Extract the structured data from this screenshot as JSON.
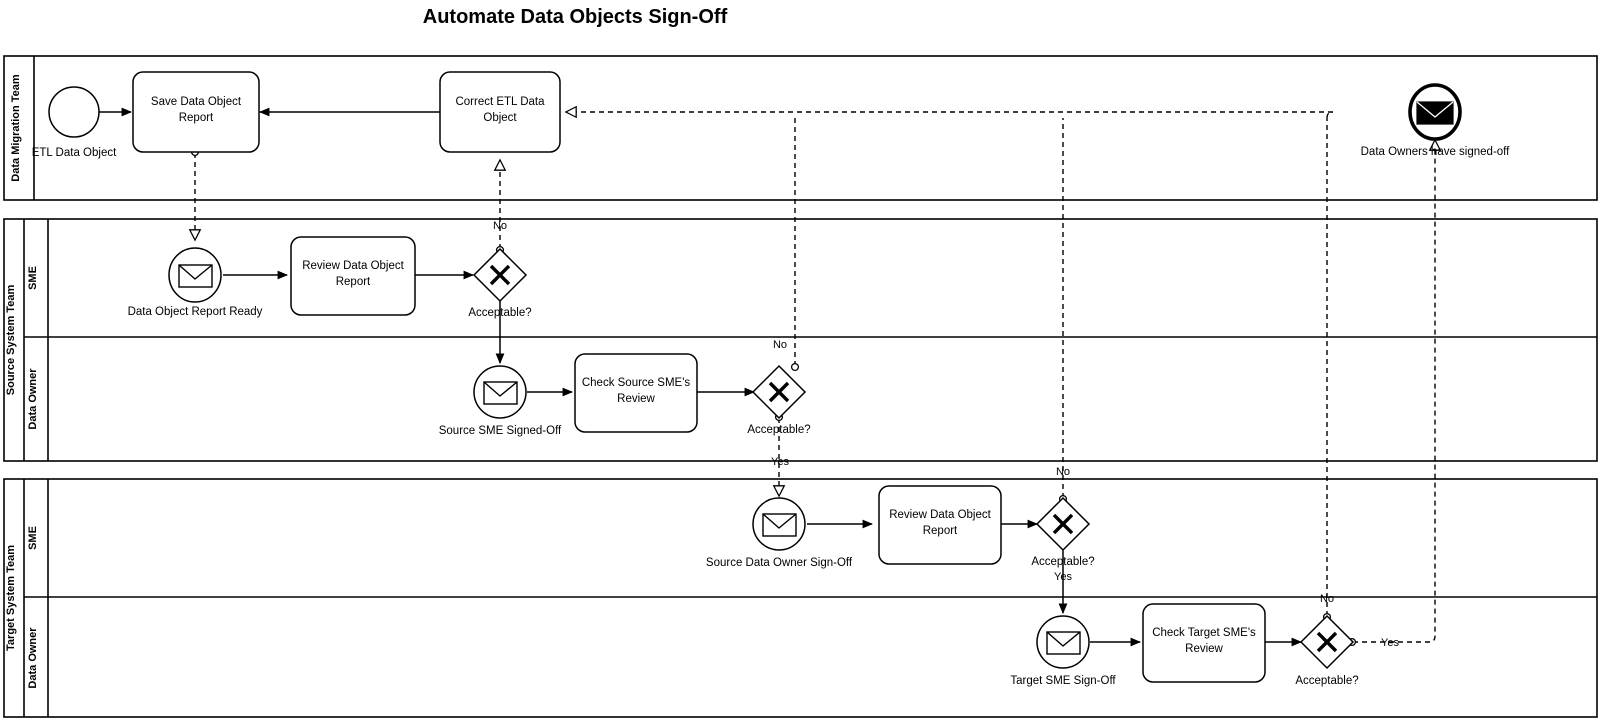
{
  "title": "Automate Data Objects Sign-Off",
  "colors": {
    "stroke": "#000000",
    "background": "#ffffff",
    "text": "#000000"
  },
  "pools": [
    {
      "id": "pool-data-migration-team",
      "label": "Data Migration Team",
      "lanes": []
    },
    {
      "id": "pool-source-system-team",
      "label": "Source System Team",
      "lanes": [
        {
          "id": "lane-source-sme",
          "label": "SME"
        },
        {
          "id": "lane-source-data-owner",
          "label": "Data Owner"
        }
      ]
    },
    {
      "id": "pool-target-system-team",
      "label": "Target System Team",
      "lanes": [
        {
          "id": "lane-target-sme",
          "label": "SME"
        },
        {
          "id": "lane-target-data-owner",
          "label": "Data Owner"
        }
      ]
    }
  ],
  "events": [
    {
      "id": "start-etl-data-object",
      "label": "ETL Data Object",
      "type": "start-none",
      "icon": "circle-plain"
    },
    {
      "id": "event-data-object-report-ready",
      "label": "Data Object Report Ready",
      "type": "intermediate-message-catch",
      "icon": "envelope-icon"
    },
    {
      "id": "event-source-sme-signed-off",
      "label": "Source SME Signed-Off",
      "type": "intermediate-message-catch",
      "icon": "envelope-icon"
    },
    {
      "id": "event-source-data-owner-sign-off",
      "label": "Source Data Owner Sign-Off",
      "type": "intermediate-message-catch",
      "icon": "envelope-icon"
    },
    {
      "id": "event-target-sme-sign-off",
      "label": "Target SME Sign-Off",
      "type": "intermediate-message-catch",
      "icon": "envelope-icon"
    },
    {
      "id": "end-data-owners-have-signed-off",
      "label": "Data Owners have signed-off",
      "type": "end-message-throw",
      "icon": "envelope-filled-icon"
    }
  ],
  "tasks": [
    {
      "id": "task-save-data-object-report",
      "lines": [
        "Save Data Object",
        "Report"
      ]
    },
    {
      "id": "task-correct-etl-data-object",
      "lines": [
        "Correct ETL Data",
        "Object"
      ]
    },
    {
      "id": "task-review-data-object-report-source",
      "lines": [
        "Review Data Object",
        "Report"
      ]
    },
    {
      "id": "task-check-source-smes-review",
      "lines": [
        "Check Source SME's",
        "Review"
      ]
    },
    {
      "id": "task-review-data-object-report-target",
      "lines": [
        "Review Data Object",
        "Report"
      ]
    },
    {
      "id": "task-check-target-smes-review",
      "lines": [
        "Check Target SME's",
        "Review"
      ]
    }
  ],
  "gateways": [
    {
      "id": "gw-acceptable-source-sme",
      "label": "Acceptable?",
      "type": "exclusive",
      "marker": "X"
    },
    {
      "id": "gw-acceptable-source-data-owner",
      "label": "Acceptable?",
      "type": "exclusive",
      "marker": "X"
    },
    {
      "id": "gw-acceptable-target-sme",
      "label": "Acceptable?",
      "type": "exclusive",
      "marker": "X"
    },
    {
      "id": "gw-acceptable-target-data-owner",
      "label": "Acceptable?",
      "type": "exclusive",
      "marker": "X"
    }
  ],
  "edge_labels": {
    "source_sme_no": "No",
    "source_data_owner_no": "No",
    "source_data_owner_yes": "Yes",
    "target_sme_no": "No",
    "target_sme_yes": "Yes",
    "target_data_owner_no": "No",
    "target_data_owner_yes": "Yes"
  }
}
